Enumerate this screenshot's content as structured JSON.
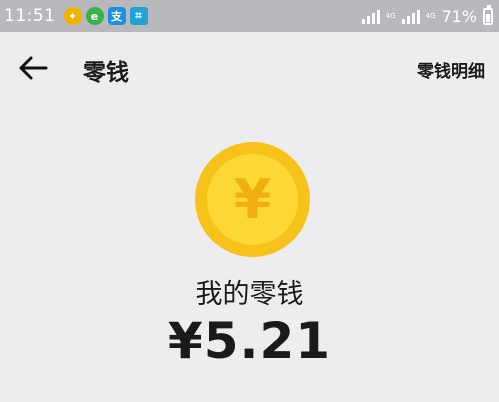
{
  "status_bar": {
    "time": "11:51",
    "network_1": "4G",
    "network_2": "4G",
    "battery_percent": "71%",
    "battery_level": 0.71,
    "app_icons": [
      "qq-icon",
      "browser-icon",
      "alipay-icon",
      "scan-icon"
    ]
  },
  "header": {
    "back_icon": "arrow-left-icon",
    "title": "零钱",
    "detail_link": "零钱明细"
  },
  "wallet": {
    "coin_symbol": "¥",
    "label": "我的零钱",
    "balance": "¥5.21"
  },
  "colors": {
    "coin_outer": "#f7c31b",
    "coin_inner": "#fdd835",
    "coin_symbol": "#f2ad0e",
    "status_bar": "#b9b9bd",
    "background": "#ededf0"
  }
}
